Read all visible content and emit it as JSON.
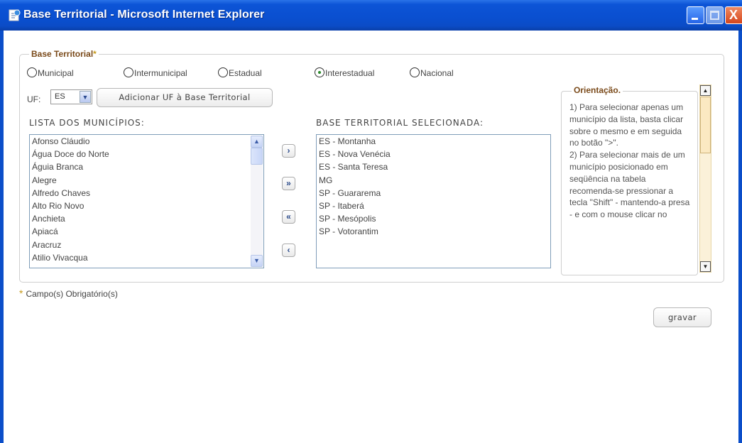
{
  "window": {
    "title": "Base Territorial - Microsoft Internet Explorer",
    "close_glyph": "X"
  },
  "section": {
    "legend": "Base Territorial",
    "required_star": "*"
  },
  "scope_options": [
    {
      "label": "Municipal",
      "checked": false
    },
    {
      "label": "Intermunicipal",
      "checked": false
    },
    {
      "label": "Estadual",
      "checked": false
    },
    {
      "label": "Interestadual",
      "checked": true
    },
    {
      "label": "Nacional",
      "checked": false
    }
  ],
  "uf": {
    "label": "UF:",
    "selected": "ES",
    "add_button": "Adicionar UF à Base Territorial"
  },
  "municipios": {
    "heading": "LISTA DOS MUNICÍPIOS:",
    "items": [
      "Afonso Cláudio",
      "Água Doce do Norte",
      "Águia Branca",
      "Alegre",
      "Alfredo Chaves",
      "Alto Rio Novo",
      "Anchieta",
      "Apiacá",
      "Aracruz",
      "Atilio Vivacqua"
    ]
  },
  "move_buttons": {
    "add_one": "›",
    "add_all": "»",
    "remove_all": "«",
    "remove_one": "‹"
  },
  "selecionada": {
    "heading": "BASE TERRITORIAL SELECIONADA:",
    "items": [
      "ES - Montanha",
      "ES - Nova Venécia",
      "ES - Santa Teresa",
      "MG",
      "SP - Guararema",
      "SP - Itaberá",
      "SP - Mesópolis",
      "SP - Votorantim"
    ]
  },
  "orientacao": {
    "title": "Orientação.",
    "paragraphs": [
      "1) Para selecionar apenas um município da lista, basta clicar sobre o mesmo e em seguida no botão \">\".",
      "2) Para selecionar mais de um município posicionado em seqüência na tabela recomenda-se pressionar a tecla \"Shift\" - mantendo-a presa - e com o mouse clicar no"
    ]
  },
  "footer": {
    "required_note": "Campo(s) Obrigatório(s)",
    "save_button": "gravar"
  },
  "colors": {
    "titlebar": "#0a4fd0",
    "legend_text": "#7a4a1a",
    "required_star": "#c79a1a"
  }
}
